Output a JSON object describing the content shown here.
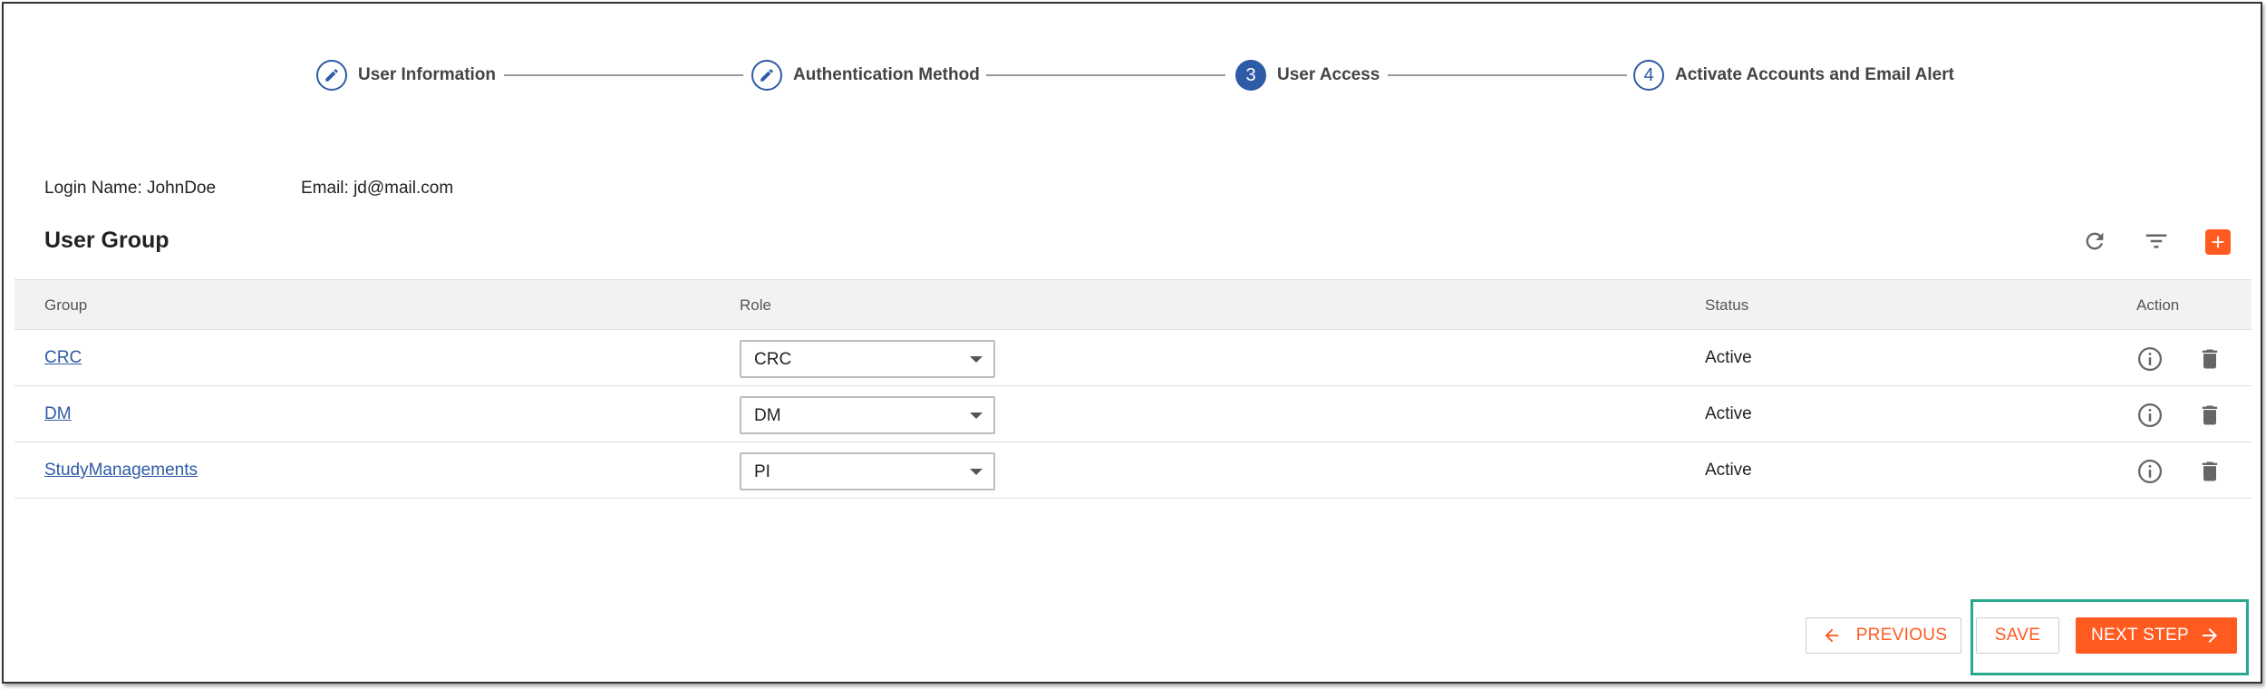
{
  "stepper": {
    "steps": [
      {
        "label": "User Information",
        "marker": "edit"
      },
      {
        "label": "Authentication Method",
        "marker": "edit"
      },
      {
        "label": "User Access",
        "marker": "3"
      },
      {
        "label": "Activate Accounts and Email Alert",
        "marker": "4"
      }
    ]
  },
  "user": {
    "login": "Login Name: JohnDoe",
    "email": "Email: jd@mail.com"
  },
  "section": {
    "title": "User Group",
    "toolbar": [
      "refresh-icon",
      "filter-icon",
      "add-icon"
    ]
  },
  "table": {
    "headers": {
      "group": "Group",
      "role": "Role",
      "status": "Status",
      "action": "Action"
    },
    "rows": [
      {
        "group": "CRC",
        "role": "CRC",
        "status": "Active"
      },
      {
        "group": "DM",
        "role": "DM",
        "status": "Active"
      },
      {
        "group": "StudyManagements",
        "role": "PI",
        "status": "Active"
      }
    ]
  },
  "footer": {
    "previous": "PREVIOUS",
    "save": "SAVE",
    "next": "NEXT STEP"
  },
  "colors": {
    "accent": "#ff5a1f",
    "primary": "#2d5ba5",
    "highlight": "#2aa88f"
  }
}
